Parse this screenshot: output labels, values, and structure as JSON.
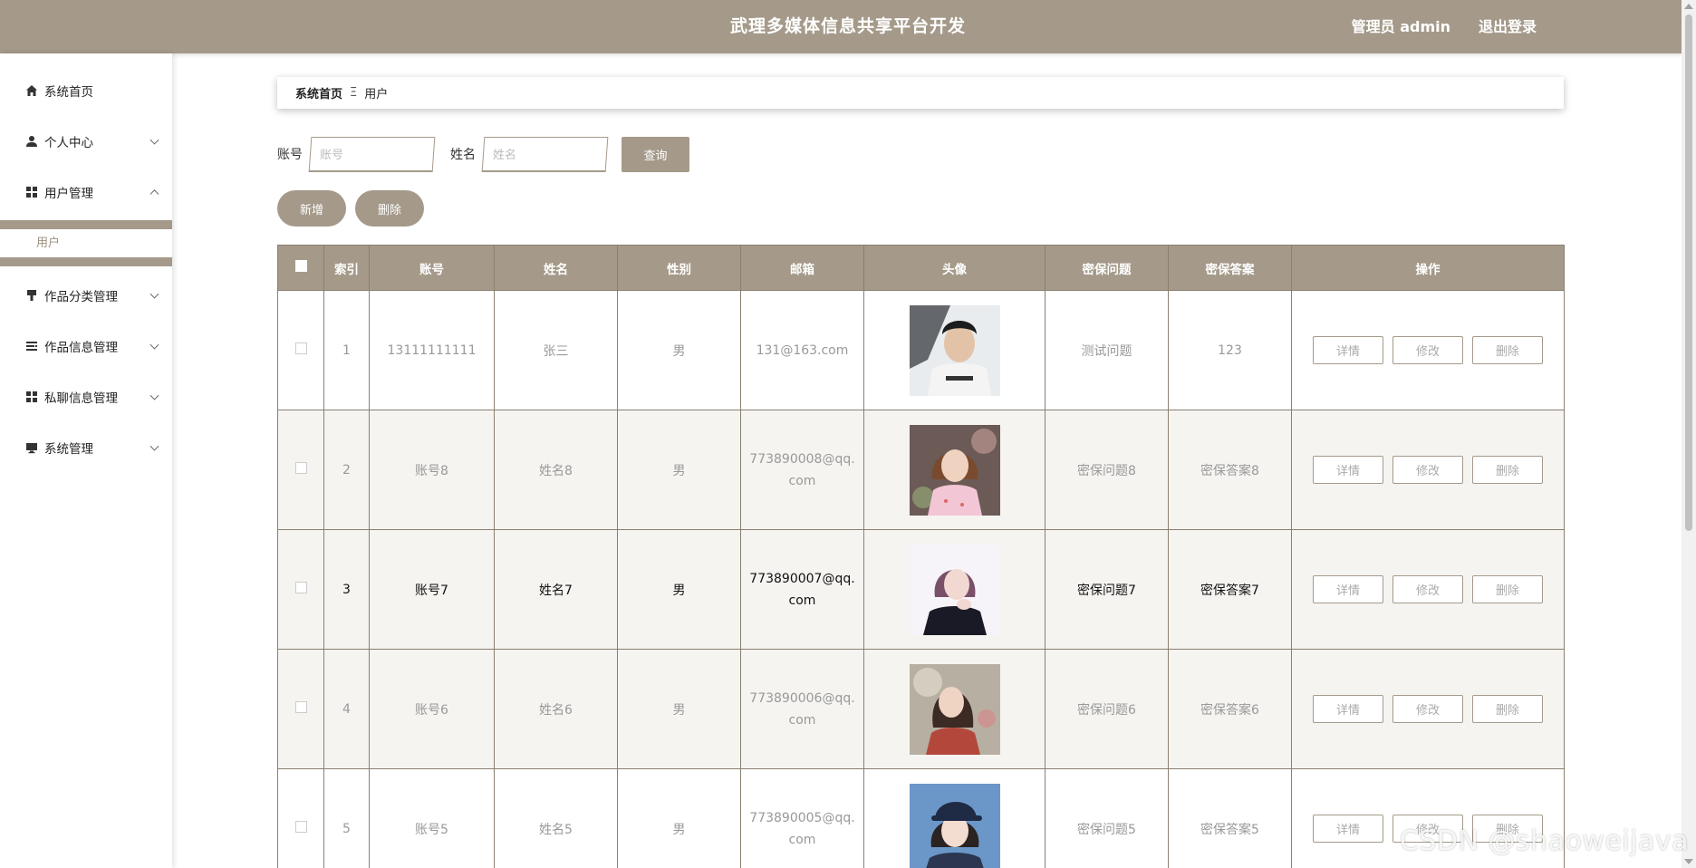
{
  "header": {
    "title": "武理多媒体信息共享平台开发",
    "user_label": "管理员 admin",
    "logout_label": "退出登录"
  },
  "sidebar": {
    "items": [
      {
        "label": "系统首页",
        "icon": "home-icon"
      },
      {
        "label": "个人中心",
        "icon": "user-icon"
      },
      {
        "label": "用户管理",
        "icon": "grid-icon",
        "expanded": true,
        "children": [
          {
            "label": "用户"
          }
        ]
      },
      {
        "label": "作品分类管理",
        "icon": "brush-icon"
      },
      {
        "label": "作品信息管理",
        "icon": "list-icon"
      },
      {
        "label": "私聊信息管理",
        "icon": "grid-icon"
      },
      {
        "label": "系统管理",
        "icon": "monitor-icon"
      }
    ]
  },
  "breadcrumb": {
    "home": "系统首页",
    "separator": "Ξ",
    "current": "用户"
  },
  "search": {
    "account_label": "账号",
    "account_placeholder": "账号",
    "name_label": "姓名",
    "name_placeholder": "姓名",
    "query_label": "查询"
  },
  "actions": {
    "add_label": "新增",
    "delete_label": "删除"
  },
  "table": {
    "headers": [
      "索引",
      "账号",
      "姓名",
      "性别",
      "邮箱",
      "头像",
      "密保问题",
      "密保答案",
      "操作"
    ],
    "op_labels": {
      "detail": "详情",
      "edit": "修改",
      "delete": "删除"
    },
    "rows": [
      {
        "index": "1",
        "account": "13111111111",
        "name": "张三",
        "gender": "男",
        "email": "131@163.com",
        "question": "测试问题",
        "answer": "123",
        "avatar": "avatar-man"
      },
      {
        "index": "2",
        "account": "账号8",
        "name": "姓名8",
        "gender": "男",
        "email": "773890008@qq.com",
        "question": "密保问题8",
        "answer": "密保答案8",
        "avatar": "avatar-woman-pink"
      },
      {
        "index": "3",
        "account": "账号7",
        "name": "姓名7",
        "gender": "男",
        "email": "773890007@qq.com",
        "question": "密保问题7",
        "answer": "密保答案7",
        "avatar": "avatar-woman-dark"
      },
      {
        "index": "4",
        "account": "账号6",
        "name": "姓名6",
        "gender": "男",
        "email": "773890006@qq.com",
        "question": "密保问题6",
        "answer": "密保答案6",
        "avatar": "avatar-woman-outdoor"
      },
      {
        "index": "5",
        "account": "账号5",
        "name": "姓名5",
        "gender": "男",
        "email": "773890005@qq.com",
        "question": "密保问题5",
        "answer": "密保答案5",
        "avatar": "avatar-woman-cap"
      }
    ]
  },
  "watermark": "CSDN @shaoweijava",
  "colors": {
    "accent": "#a59a8a",
    "border": "#8a8070",
    "alt_row": "#f5f4f1"
  }
}
